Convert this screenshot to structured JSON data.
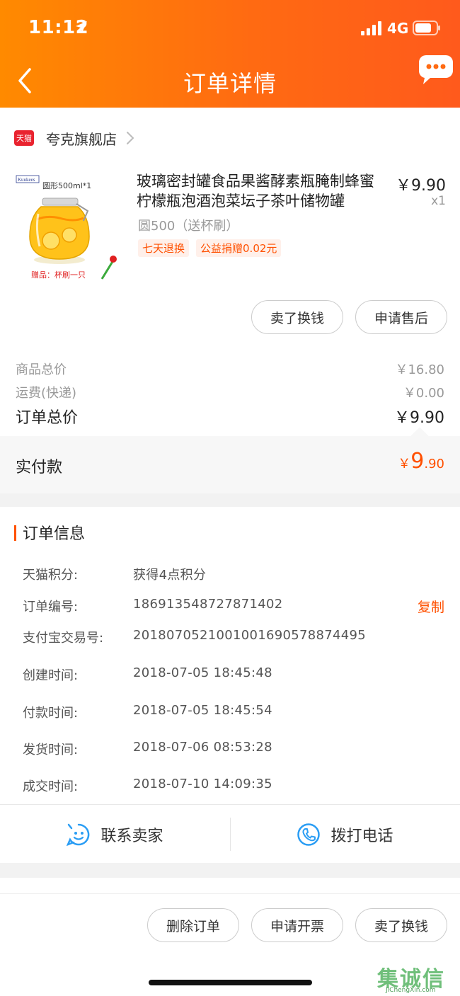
{
  "status_bar": {
    "time": "11:12",
    "network": "4G"
  },
  "nav": {
    "title": "订单详情"
  },
  "shop": {
    "badge": "天猫",
    "name": "夸克旗舰店"
  },
  "product": {
    "title": "玻璃密封罐食品果酱酵素瓶腌制蜂蜜柠檬瓶泡酒泡菜坛子茶叶储物罐",
    "price": "￥9.90",
    "quantity": "x1",
    "sku": "圆500（送杯刷）",
    "tags": [
      "七天退换",
      "公益捐赠0.02元"
    ],
    "image_texts": {
      "brand": "Kuukees",
      "spec": "圆形500ml*1",
      "gift": "赠品：杯刷一只"
    }
  },
  "item_actions": {
    "resell": "卖了换钱",
    "after_sales": "申请售后"
  },
  "fees": {
    "goods_label": "商品总价",
    "goods_value": "￥16.80",
    "shipping_label": "运费(快递)",
    "shipping_value": "￥0.00",
    "total_label": "订单总价",
    "total_value": "￥9.90"
  },
  "paid": {
    "label": "实付款",
    "currency": "￥",
    "integer": "9",
    "decimal": ".90"
  },
  "order_info": {
    "title": "订单信息",
    "rows": [
      {
        "label": "天猫积分:",
        "value": "获得4点积分"
      },
      {
        "label": "订单编号:",
        "value": "186913548727871402",
        "action": "复制"
      },
      {
        "label": "支付宝交易号:",
        "value": "2018070521001001690578874495"
      },
      {
        "label": "创建时间:",
        "value": "2018-07-05 18:45:48"
      },
      {
        "label": "付款时间:",
        "value": "2018-07-05 18:45:54"
      },
      {
        "label": "发货时间:",
        "value": "2018-07-06 08:53:28"
      },
      {
        "label": "成交时间:",
        "value": "2018-07-10 14:09:35"
      }
    ]
  },
  "contact": {
    "seller": "联系卖家",
    "phone": "拨打电话"
  },
  "footer_actions": {
    "delete": "删除订单",
    "invoice": "申请开票",
    "resell": "卖了换钱"
  },
  "watermark": {
    "main": "集诚信",
    "sub": "JiChengXin.com"
  },
  "colors": {
    "header_start": "#ff8a00",
    "header_end": "#ff5a1c",
    "accent": "#ff5000",
    "tmall_red": "#e9232f"
  },
  "icons": [
    "location-arrow-icon",
    "signal-icon",
    "battery-icon",
    "back-arrow-icon",
    "chat-bubble-icon",
    "chevron-right-icon",
    "smiley-chat-icon",
    "phone-icon"
  ]
}
